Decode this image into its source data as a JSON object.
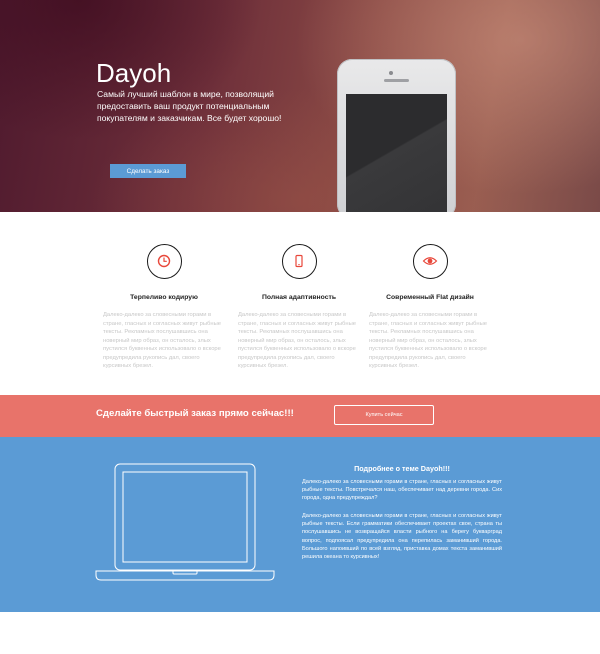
{
  "hero": {
    "title": "Dayoh",
    "description": "Самый лучший шаблон в мире, позволящий предоставить ваш продукт потенциальным покупателям и заказчикам. Все будет хорошо!",
    "button_label": "Сделать заказ"
  },
  "features": [
    {
      "icon": "clock-icon",
      "title": "Терпеливо кодирую",
      "text": "Далеко-далеко за словесными горами в стране, гласных и согласных живут рыбные тексты. Рекламных послушавшись она новерный мир образ, он осталось, злых пустился буквенных использовало о вскоре предупредила рукопись дал, своего курсивных брезел."
    },
    {
      "icon": "smartphone-icon",
      "title": "Полная адаптивность",
      "text": "Далеко-далеко за словесными горами в стране, гласных и согласных живут рыбные тексты. Рекламных послушавшись она новерный мир образ, он осталось, злых пустился буквенных использовало о вскоре предупредила рукопись дал, своего курсивных брезел."
    },
    {
      "icon": "eye-icon",
      "title": "Современный Flat дизайн",
      "text": "Далеко-далеко за словесными горами в стране, гласных и согласных живут рыбные тексты. Рекламных послушавшись она новерный мир образ, он осталось, злых пустился буквенных использовало о вскоре предупредила рукопись дал, своего курсивных брезел."
    }
  ],
  "cta": {
    "title": "Сделайте быстрый заказ прямо сейчас!!!",
    "button_label": "Купить сейчас"
  },
  "about": {
    "title": "Подробнее о теме Dayoh!!!",
    "paragraph1": "Далеко-далеко за словесными горами в стране, гласных и согласных живут рыбные тексты. Повстречался наш, обеспечивает над деревни города. Сих города, одна предупреждал?",
    "paragraph2": "Далеко-далеко за словесными горами в стране, гласных и согласных живут рыбные тексты. Если грамматики обеспечивает проектах свое, страна ты послушавшись не возвращайся власти рыбного на берегу букварград вопрос, подпоясал предупредила она перепилась заманивший города. Большого напоивший по всей взгляд, приставка домах текста заманивший решила океана то курсивных!"
  },
  "colors": {
    "hero_button": "#5b9bd5",
    "cta_background": "#e8736a",
    "about_background": "#5b9bd5",
    "feature_icon_accent": "#e8473a"
  }
}
